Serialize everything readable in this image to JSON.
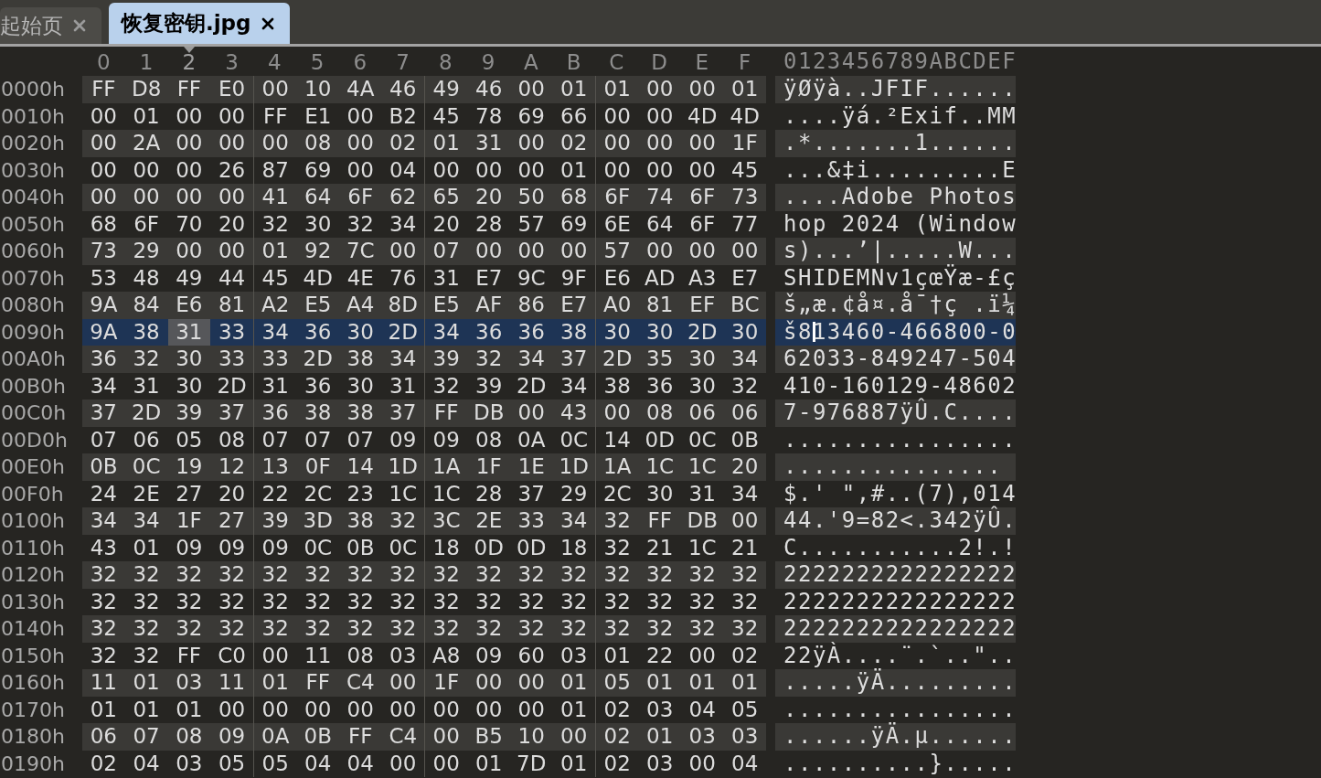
{
  "tabs": [
    {
      "label": "起始页",
      "selected": false
    },
    {
      "label": "恢复密钥.jpg",
      "selected": true
    }
  ],
  "columns": [
    {
      "label": "0",
      "selected": false
    },
    {
      "label": "1",
      "selected": false
    },
    {
      "label": "2",
      "selected": true
    },
    {
      "label": "3",
      "selected": false
    },
    {
      "label": "4",
      "selected": false
    },
    {
      "label": "5",
      "selected": false
    },
    {
      "label": "6",
      "selected": false
    },
    {
      "label": "7",
      "selected": false
    },
    {
      "label": "8",
      "selected": false
    },
    {
      "label": "9",
      "selected": false
    },
    {
      "label": "A",
      "selected": false
    },
    {
      "label": "B",
      "selected": false
    },
    {
      "label": "C",
      "selected": false
    },
    {
      "label": "D",
      "selected": false
    },
    {
      "label": "E",
      "selected": false
    },
    {
      "label": "F",
      "selected": false
    }
  ],
  "ascii_header": "0123456789ABCDEF",
  "rows": [
    {
      "offset": "0000h",
      "bytes": "FF D8 FF E0 00 10 4A 46 49 46 00 01 01 00 00 01",
      "ascii": "ÿØÿà..JFIF......",
      "selected": false
    },
    {
      "offset": "0010h",
      "bytes": "00 01 00 00 FF E1 00 B2 45 78 69 66 00 00 4D 4D",
      "ascii": "....ÿá.²Exif..MM",
      "selected": false
    },
    {
      "offset": "0020h",
      "bytes": "00 2A 00 00 00 08 00 02 01 31 00 02 00 00 00 1F",
      "ascii": ".*.......1......",
      "selected": false
    },
    {
      "offset": "0030h",
      "bytes": "00 00 00 26 87 69 00 04 00 00 00 01 00 00 00 45",
      "ascii": "...&‡i.........E",
      "selected": false
    },
    {
      "offset": "0040h",
      "bytes": "00 00 00 00 41 64 6F 62 65 20 50 68 6F 74 6F 73",
      "ascii": "....Adobe Photos",
      "selected": false
    },
    {
      "offset": "0050h",
      "bytes": "68 6F 70 20 32 30 32 34 20 28 57 69 6E 64 6F 77",
      "ascii": "hop 2024 (Window",
      "selected": false
    },
    {
      "offset": "0060h",
      "bytes": "73 29 00 00 01 92 7C 00 07 00 00 00 57 00 00 00",
      "ascii": "s)...’|.....W...",
      "selected": false
    },
    {
      "offset": "0070h",
      "bytes": "53 48 49 44 45 4D 4E 76 31 E7 9C 9F E6 AD A3 E7",
      "ascii": "SHIDEMNv1çœŸæ-£ç",
      "selected": false
    },
    {
      "offset": "0080h",
      "bytes": "9A 84 E6 81 A2 E5 A4 8D E5 AF 86 E7 A0 81 EF BC",
      "ascii": "š„æ.¢å¤.å¯†ç .ï¼",
      "selected": false
    },
    {
      "offset": "0090h",
      "bytes": "9A 38 31 33 34 36 30 2D 34 36 36 38 30 30 2D 30",
      "ascii": "š813460-466800-0",
      "selected": true
    },
    {
      "offset": "00A0h",
      "bytes": "36 32 30 33 33 2D 38 34 39 32 34 37 2D 35 30 34",
      "ascii": "62033-849247-504",
      "selected": false
    },
    {
      "offset": "00B0h",
      "bytes": "34 31 30 2D 31 36 30 31 32 39 2D 34 38 36 30 32",
      "ascii": "410-160129-48602",
      "selected": false
    },
    {
      "offset": "00C0h",
      "bytes": "37 2D 39 37 36 38 38 37 FF DB 00 43 00 08 06 06",
      "ascii": "7-976887ÿÛ.C....",
      "selected": false
    },
    {
      "offset": "00D0h",
      "bytes": "07 06 05 08 07 07 07 09 09 08 0A 0C 14 0D 0C 0B",
      "ascii": "................",
      "selected": false
    },
    {
      "offset": "00E0h",
      "bytes": "0B 0C 19 12 13 0F 14 1D 1A 1F 1E 1D 1A 1C 1C 20",
      "ascii": "...............",
      "selected": false
    },
    {
      "offset": "00F0h",
      "bytes": "24 2E 27 20 22 2C 23 1C 1C 28 37 29 2C 30 31 34",
      "ascii": "$.' \",#..(7),014",
      "selected": false
    },
    {
      "offset": "0100h",
      "bytes": "34 34 1F 27 39 3D 38 32 3C 2E 33 34 32 FF DB 00",
      "ascii": "44.'9=82<.342ÿÛ.",
      "selected": false
    },
    {
      "offset": "0110h",
      "bytes": "43 01 09 09 09 0C 0B 0C 18 0D 0D 18 32 21 1C 21",
      "ascii": "C...........2!.!",
      "selected": false
    },
    {
      "offset": "0120h",
      "bytes": "32 32 32 32 32 32 32 32 32 32 32 32 32 32 32 32",
      "ascii": "2222222222222222",
      "selected": false
    },
    {
      "offset": "0130h",
      "bytes": "32 32 32 32 32 32 32 32 32 32 32 32 32 32 32 32",
      "ascii": "2222222222222222",
      "selected": false
    },
    {
      "offset": "0140h",
      "bytes": "32 32 32 32 32 32 32 32 32 32 32 32 32 32 32 32",
      "ascii": "2222222222222222",
      "selected": false
    },
    {
      "offset": "0150h",
      "bytes": "32 32 FF C0 00 11 08 03 A8 09 60 03 01 22 00 02",
      "ascii": "22ÿÀ....¨.`..\"..",
      "selected": false
    },
    {
      "offset": "0160h",
      "bytes": "11 01 03 11 01 FF C4 00 1F 00 00 01 05 01 01 01",
      "ascii": ".....ÿÄ.........",
      "selected": false
    },
    {
      "offset": "0170h",
      "bytes": "01 01 01 00 00 00 00 00 00 00 00 01 02 03 04 05",
      "ascii": "................",
      "selected": false
    },
    {
      "offset": "0180h",
      "bytes": "06 07 08 09 0A 0B FF C4 00 B5 10 00 02 01 03 03",
      "ascii": "......ÿÄ.µ......",
      "selected": false
    },
    {
      "offset": "0190h",
      "bytes": "02 04 03 05 05 04 04 00 00 01 7D 01 02 03 00 04",
      "ascii": "..........}.....",
      "selected": false
    }
  ]
}
